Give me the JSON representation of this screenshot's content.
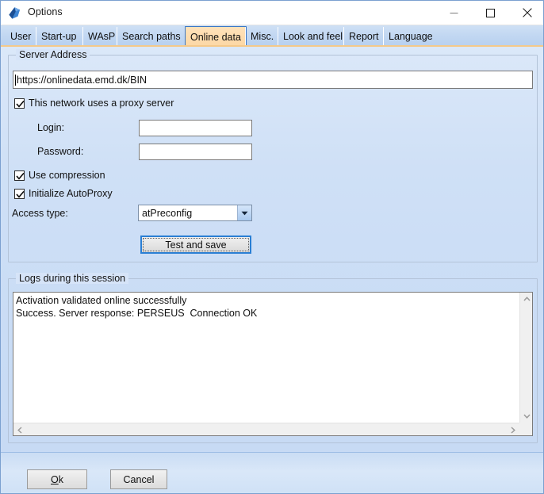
{
  "window": {
    "title": "Options",
    "icon": "app-gem-icon",
    "controls": {
      "minimize": "minimize-icon",
      "maximize": "maximize-icon",
      "close": "close-icon"
    }
  },
  "tabs": {
    "active_index": 4,
    "items": [
      {
        "label": "User"
      },
      {
        "label": "Start-up"
      },
      {
        "label": "WAsP"
      },
      {
        "label": "Search paths"
      },
      {
        "label": "Online data"
      },
      {
        "label": "Misc."
      },
      {
        "label": "Look and feel"
      },
      {
        "label": "Report"
      },
      {
        "label": "Language"
      }
    ]
  },
  "server_address": {
    "group_title": "Server Address",
    "value": "https://onlinedata.emd.dk/BIN"
  },
  "proxy": {
    "checkbox_label": "This network uses a proxy server",
    "checked": true,
    "login_label": "Login:",
    "login_value": "",
    "password_label": "Password:",
    "password_value": ""
  },
  "options": {
    "use_compression_label": "Use compression",
    "use_compression_checked": true,
    "initialize_autoproxy_label": "Initialize AutoProxy",
    "initialize_autoproxy_checked": true,
    "access_type_label": "Access type:",
    "access_type_value": "atPreconfig",
    "access_type_options": [
      "atPreconfig"
    ]
  },
  "actions": {
    "test_and_save_label": "Test and save"
  },
  "logs": {
    "group_title": "Logs during this session",
    "lines": [
      "Activation validated online successfully",
      "Success. Server response: PERSEUS  Connection OK"
    ],
    "scrollbars": {
      "up_arrow": "chevron-up-icon",
      "down_arrow": "chevron-down-icon",
      "left_arrow": "chevron-left-icon",
      "right_arrow": "chevron-right-icon"
    }
  },
  "footer": {
    "ok_label": "Ok",
    "ok_accel": "O",
    "ok_rest": "k",
    "cancel_label": "Cancel"
  },
  "colors": {
    "panel_bg": "#cfe0f6",
    "active_tab": "#fcd7a4",
    "tab_underline": "#f4c98a",
    "focus_blue": "#2a7fd4",
    "window_border": "#7ba0d0"
  }
}
